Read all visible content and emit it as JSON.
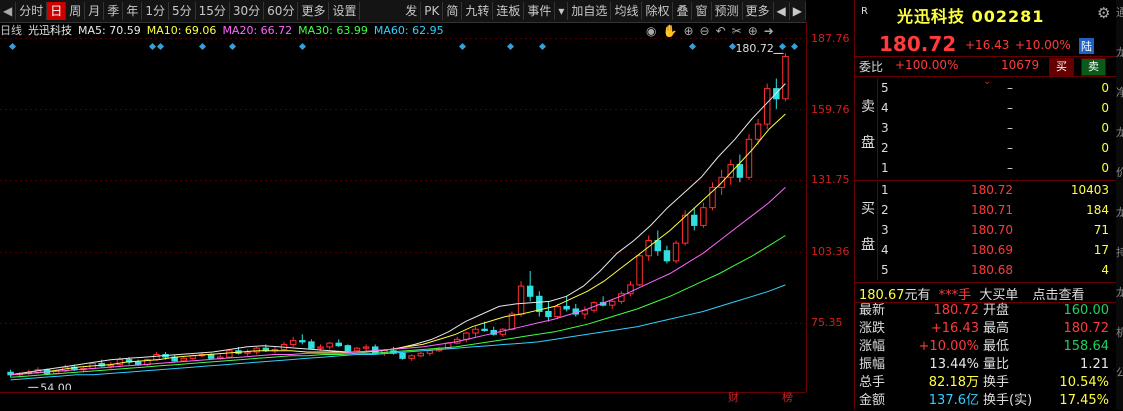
{
  "toolbar": {
    "items": [
      "◀",
      "分时",
      "日",
      "周",
      "月",
      "季",
      "年",
      "1分",
      "5分",
      "15分",
      "30分",
      "60分",
      "更多",
      "设置"
    ],
    "items_right": [
      "发",
      "PK",
      "简",
      "九转",
      "连板",
      "事件",
      "▾",
      "加自选",
      "均线",
      "除权",
      "叠",
      "窗",
      "预测",
      "更多",
      "◀",
      "▶"
    ]
  },
  "ma": {
    "title": "日线",
    "name": "光迅科技",
    "ma5": "MA5: 70.59",
    "ma10": "MA10: 69.06",
    "ma20": "MA20: 66.72",
    "ma30": "MA30: 63.99",
    "ma60": "MA60: 62.95",
    "colors": {
      "ma5": "#e8e8e8",
      "ma10": "#ffff40",
      "ma20": "#ff66ff",
      "ma30": "#40ff40",
      "ma60": "#30d0ff"
    }
  },
  "chart_icons": [
    "eye-icon",
    "hand-icon",
    "zoom-in-icon",
    "zoom-out-icon",
    "undo-icon",
    "scissors-icon",
    "plus-icon",
    "arrow-icon"
  ],
  "chart_data": {
    "type": "candlestick",
    "yticks": [
      "187.76",
      "159.76",
      "131.75",
      "103.36",
      "75.35"
    ],
    "ylim": [
      49,
      188
    ],
    "peak_label": "180.72",
    "low_label": "54.00",
    "ohlc": [
      [
        56,
        57,
        54,
        55
      ],
      [
        55,
        56,
        54,
        55.5
      ],
      [
        55.5,
        57,
        55,
        56
      ],
      [
        56,
        58,
        55.5,
        57
      ],
      [
        57,
        57.5,
        55,
        55.5
      ],
      [
        55.5,
        57,
        55,
        56.5
      ],
      [
        56.5,
        59,
        56,
        58
      ],
      [
        58,
        59,
        56.5,
        57
      ],
      [
        57,
        58,
        56,
        57.5
      ],
      [
        57.5,
        60,
        57,
        59.5
      ],
      [
        59.5,
        61,
        58,
        58.5
      ],
      [
        58.5,
        60,
        57.5,
        59
      ],
      [
        59,
        62,
        58.5,
        61
      ],
      [
        61,
        62,
        59,
        60
      ],
      [
        60,
        61,
        58.5,
        59
      ],
      [
        59,
        61.5,
        58.5,
        61
      ],
      [
        61,
        64,
        60.5,
        63
      ],
      [
        63,
        64,
        61,
        62
      ],
      [
        62,
        63,
        60,
        60.5
      ],
      [
        60.5,
        62,
        60,
        61.5
      ],
      [
        61.5,
        63,
        61,
        62.5
      ],
      [
        62.5,
        64,
        62,
        63
      ],
      [
        63,
        63.5,
        61,
        61.5
      ],
      [
        61.5,
        63,
        61,
        62
      ],
      [
        62,
        65,
        61.5,
        64.5
      ],
      [
        64.5,
        66,
        63,
        63.5
      ],
      [
        63.5,
        65,
        62.5,
        64
      ],
      [
        64,
        66,
        63,
        65.5
      ],
      [
        65.5,
        67,
        64,
        64.5
      ],
      [
        64.5,
        66,
        63.5,
        65
      ],
      [
        65,
        68,
        64.5,
        67
      ],
      [
        67,
        70,
        66,
        68.5
      ],
      [
        68.5,
        71,
        67,
        68
      ],
      [
        68,
        69,
        65,
        65.5
      ],
      [
        65.5,
        67,
        64.5,
        66
      ],
      [
        66,
        68,
        65,
        67.5
      ],
      [
        67.5,
        69,
        66,
        66.5
      ],
      [
        66.5,
        67,
        64,
        64.5
      ],
      [
        64.5,
        66,
        63.5,
        65.5
      ],
      [
        65.5,
        67,
        64.5,
        66
      ],
      [
        66,
        67,
        63,
        63.5
      ],
      [
        63.5,
        65,
        62.5,
        64.5
      ],
      [
        64.5,
        66,
        63,
        63.5
      ],
      [
        63.5,
        64,
        61,
        61.5
      ],
      [
        61.5,
        63,
        60.5,
        62.5
      ],
      [
        62.5,
        64,
        62,
        63.5
      ],
      [
        63.5,
        65,
        62.5,
        64.5
      ],
      [
        64.5,
        66,
        64,
        65.5
      ],
      [
        65.5,
        68,
        65,
        67.5
      ],
      [
        67.5,
        70,
        67,
        69
      ],
      [
        69,
        72,
        68,
        71.5
      ],
      [
        71.5,
        74,
        70,
        73
      ],
      [
        73,
        76,
        72,
        72.5
      ],
      [
        72.5,
        74,
        70.5,
        71
      ],
      [
        71,
        73.5,
        70,
        73
      ],
      [
        73,
        80,
        72.5,
        79
      ],
      [
        79,
        92,
        78,
        90
      ],
      [
        90,
        96,
        84,
        86
      ],
      [
        86,
        88,
        78,
        80
      ],
      [
        80,
        84,
        76,
        78
      ],
      [
        78,
        83,
        77,
        82
      ],
      [
        82,
        86,
        80,
        81
      ],
      [
        81,
        83,
        78,
        79
      ],
      [
        79,
        82,
        77,
        80.5
      ],
      [
        80.5,
        84,
        79.5,
        83.5
      ],
      [
        83.5,
        86,
        82,
        82.5
      ],
      [
        82.5,
        85,
        81,
        84
      ],
      [
        84,
        88,
        83,
        87
      ],
      [
        87,
        92,
        86,
        90.5
      ],
      [
        90.5,
        103,
        90,
        102
      ],
      [
        102,
        110,
        100,
        108
      ],
      [
        108,
        112,
        102,
        104
      ],
      [
        104,
        106,
        99,
        100
      ],
      [
        100,
        108,
        99,
        107
      ],
      [
        107,
        120,
        106,
        118
      ],
      [
        118,
        121,
        112,
        114
      ],
      [
        114,
        123,
        113,
        121
      ],
      [
        121,
        131,
        120,
        129
      ],
      [
        129,
        136,
        126,
        133
      ],
      [
        133,
        140,
        130,
        138
      ],
      [
        138,
        142,
        131,
        133
      ],
      [
        133,
        150,
        132,
        148
      ],
      [
        148,
        156,
        146,
        154
      ],
      [
        154,
        170,
        152,
        168
      ],
      [
        168,
        172,
        160,
        164
      ],
      [
        164,
        182,
        163,
        180.72
      ]
    ],
    "ma_lines": {
      "ma5": [
        55,
        56,
        57,
        58,
        59,
        60,
        61,
        61.5,
        62,
        62.5,
        63,
        63.5,
        64,
        65,
        66,
        66.5,
        66,
        65.5,
        65,
        64.5,
        64,
        64,
        64.5,
        65.5,
        67,
        69,
        72,
        76,
        79,
        82,
        83,
        83.5,
        84,
        86,
        90,
        96,
        103,
        108,
        114,
        121,
        127,
        133,
        141,
        148,
        156,
        163,
        170
      ],
      "ma10": [
        55,
        55.5,
        56,
        57,
        58,
        58.5,
        59,
        60,
        60.5,
        61,
        62,
        62.5,
        63,
        63.5,
        64,
        64.5,
        64.5,
        64.5,
        64,
        64,
        64,
        64,
        64.5,
        65,
        66,
        67,
        69,
        71,
        74,
        76,
        78,
        79,
        80.5,
        82,
        85,
        88,
        92,
        97,
        102,
        107,
        112,
        118,
        124,
        130,
        137,
        144,
        152,
        158
      ],
      "ma20": [
        55,
        55.5,
        56,
        56.5,
        57,
        57.5,
        58,
        58.5,
        59,
        59.5,
        60,
        60.5,
        61,
        61.5,
        62,
        62.5,
        63,
        63,
        63.5,
        63.5,
        63.5,
        64,
        64.5,
        65,
        65.5,
        66,
        67,
        68,
        69.5,
        71,
        72.5,
        74,
        75.5,
        77,
        79,
        81,
        83.5,
        86,
        89,
        92,
        95,
        99,
        103,
        108,
        113,
        118,
        123,
        129
      ],
      "ma30": [
        54,
        54.5,
        55,
        55.5,
        56,
        56.5,
        57,
        57.5,
        58,
        58.5,
        59,
        59.5,
        60,
        60.5,
        61,
        61.5,
        62,
        62.5,
        62.5,
        63,
        63,
        63.5,
        63.5,
        64,
        64.5,
        65,
        65.5,
        66,
        67,
        68,
        69,
        70,
        71,
        72,
        73.5,
        75,
        77,
        79,
        81,
        83.5,
        86,
        89,
        92,
        95,
        98.5,
        102,
        106,
        110
      ],
      "ma60": [
        53,
        53.5,
        54,
        54.5,
        55,
        55,
        55.5,
        56,
        56.5,
        57,
        57.5,
        58,
        58.5,
        59,
        59.5,
        60,
        60.5,
        61,
        61.5,
        62,
        62.5,
        63,
        63,
        63.5,
        64,
        64.5,
        65,
        65.5,
        66,
        66.5,
        67,
        67.5,
        68,
        69,
        70,
        71,
        72,
        73,
        74,
        75.5,
        77,
        78.5,
        80,
        82,
        84,
        86,
        88,
        90.5
      ]
    }
  },
  "bottom_labels": {
    "cai": "财",
    "bang": "榜"
  },
  "panel": {
    "r_badge": "R",
    "title": "光迅科技 002281",
    "gear": "gear-icon",
    "price": "180.72",
    "change": "+16.43",
    "pct": "+10.00%",
    "exchange_tag": "陆",
    "weibi_label": "委比",
    "weibi_value": "+100.00%",
    "weibi_diff": "10679",
    "buy_btn": "买",
    "sell_btn": "卖",
    "sell_label1": "卖",
    "sell_label2": "盘",
    "sell_rows": [
      {
        "lvl": "5",
        "price": "–",
        "vol": "0"
      },
      {
        "lvl": "4",
        "price": "–",
        "vol": "0"
      },
      {
        "lvl": "3",
        "price": "–",
        "vol": "0"
      },
      {
        "lvl": "2",
        "price": "–",
        "vol": "0"
      },
      {
        "lvl": "1",
        "price": "–",
        "vol": "0"
      }
    ],
    "buy_label1": "买",
    "buy_label2": "盘",
    "buy_rows": [
      {
        "lvl": "1",
        "price": "180.72",
        "vol": "10403"
      },
      {
        "lvl": "2",
        "price": "180.71",
        "vol": "184"
      },
      {
        "lvl": "3",
        "price": "180.70",
        "vol": "71"
      },
      {
        "lvl": "4",
        "price": "180.69",
        "vol": "17"
      },
      {
        "lvl": "5",
        "price": "180.68",
        "vol": "4"
      }
    ],
    "yuan_row": {
      "price": "180.67",
      "unit": "元有",
      "stars": "***手",
      "big": "大买单",
      "link": "点击查看"
    },
    "stats": [
      {
        "l1": "最新",
        "v1": "180.72",
        "c1": "red",
        "l2": "开盘",
        "v2": "160.00",
        "c2": "green"
      },
      {
        "l1": "涨跌",
        "v1": "+16.43",
        "c1": "red",
        "l2": "最高",
        "v2": "180.72",
        "c2": "red"
      },
      {
        "l1": "涨幅",
        "v1": "+10.00%",
        "c1": "red",
        "l2": "最低",
        "v2": "158.64",
        "c2": "green"
      },
      {
        "l1": "振幅",
        "v1": "13.44%",
        "c1": "wht",
        "l2": "量比",
        "v2": "1.21",
        "c2": "wht"
      },
      {
        "l1": "总手",
        "v1": "82.18万",
        "c1": "yel",
        "l2": "换手",
        "v2": "10.54%",
        "c2": "yel"
      },
      {
        "l1": "金额",
        "v1": "137.6亿",
        "c1": "cyan",
        "l2": "换手(实)",
        "v2": "17.45%",
        "c2": "yel"
      }
    ]
  },
  "right_strip": [
    "通",
    "龙",
    "净",
    "龙",
    "价",
    "龙",
    "持",
    "龙",
    "机",
    "公"
  ]
}
